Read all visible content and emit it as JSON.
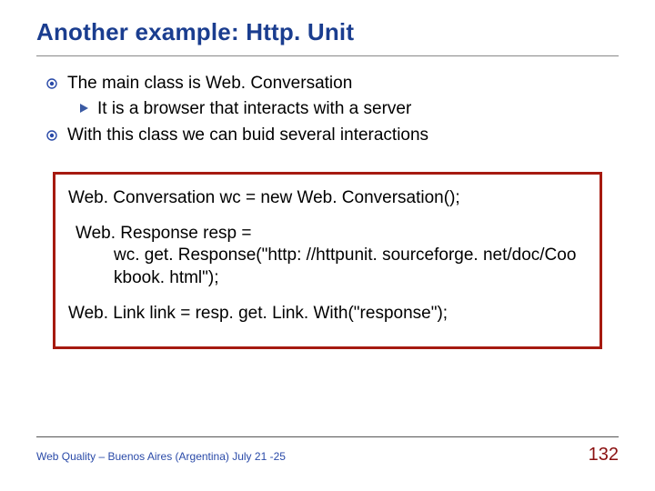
{
  "title": "Another example: Http. Unit",
  "bullets": {
    "item1": "The main class is Web. Conversation",
    "item1a": "It is a browser that interacts with a server",
    "item2": "With this class we can buid several interactions"
  },
  "code": {
    "line1": "Web. Conversation wc = new Web. Conversation();",
    "line2a": "Web. Response resp =",
    "line2b": "wc. get. Response(\"http: //httpunit. sourceforge. net/doc/Coo",
    "line2c": "kbook. html\");",
    "line3": "Web. Link link = resp. get. Link. With(\"response\");"
  },
  "footer": {
    "text": "Web Quality – Buenos Aires (Argentina) July 21 -25",
    "page": "132"
  }
}
